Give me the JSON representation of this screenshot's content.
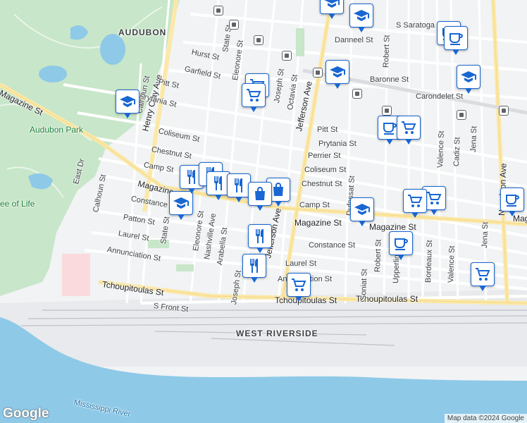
{
  "map": {
    "attribution": "Map data ©2024 Google",
    "logo": "Google",
    "areas": [
      {
        "id": "audubon",
        "text": "AUDUBON"
      },
      {
        "id": "west-riverside",
        "text": "WEST RIVERSIDE"
      }
    ],
    "parks": [
      {
        "id": "audubon-park",
        "text": "Audubon Park"
      },
      {
        "id": "tree-of-life",
        "text": "ee of Life"
      }
    ],
    "water": [
      {
        "id": "mississippi",
        "text": "Mississippi River"
      }
    ],
    "streets": [
      {
        "id": "s1",
        "text": "Henry Clay Ave"
      },
      {
        "id": "s2",
        "text": "Magazine St"
      },
      {
        "id": "s3",
        "text": "Magazine St"
      },
      {
        "id": "s4",
        "text": "Magazine St"
      },
      {
        "id": "s5",
        "text": "Magazine"
      },
      {
        "id": "s6",
        "text": "Tchoupitoulas St"
      },
      {
        "id": "s7",
        "text": "Tchoupitoulas St"
      },
      {
        "id": "s8",
        "text": "Tchoupitoulas St"
      },
      {
        "id": "s9",
        "text": "Jefferson Ave"
      },
      {
        "id": "s10",
        "text": "Jefferson Ave"
      },
      {
        "id": "s11",
        "text": "Prytania St"
      },
      {
        "id": "s12",
        "text": "Prytania St"
      },
      {
        "id": "s13",
        "text": "Coliseum St"
      },
      {
        "id": "s14",
        "text": "Coliseum St"
      },
      {
        "id": "s15",
        "text": "Chestnut St"
      },
      {
        "id": "s16",
        "text": "Chestnut St"
      },
      {
        "id": "s17",
        "text": "Camp St"
      },
      {
        "id": "s18",
        "text": "Camp St"
      },
      {
        "id": "s19",
        "text": "Constance St"
      },
      {
        "id": "s20",
        "text": "Constance St"
      },
      {
        "id": "s21",
        "text": "Patton St"
      },
      {
        "id": "s22",
        "text": "Laurel St"
      },
      {
        "id": "s23",
        "text": "Laurel St"
      },
      {
        "id": "s24",
        "text": "Annunciation St"
      },
      {
        "id": "s25",
        "text": "Annunciation St"
      },
      {
        "id": "s26",
        "text": "S Front St"
      },
      {
        "id": "s27",
        "text": "Pitt St"
      },
      {
        "id": "s28",
        "text": "Pitt St"
      },
      {
        "id": "s29",
        "text": "Garfield St"
      },
      {
        "id": "s30",
        "text": "Hurst St"
      },
      {
        "id": "s31",
        "text": "State St"
      },
      {
        "id": "s32",
        "text": "State St"
      },
      {
        "id": "s33",
        "text": "Eleonore St"
      },
      {
        "id": "s34",
        "text": "Eleonore St"
      },
      {
        "id": "s35",
        "text": "Nashville Ave"
      },
      {
        "id": "s36",
        "text": "Arabella St"
      },
      {
        "id": "s37",
        "text": "Joseph St"
      },
      {
        "id": "s38",
        "text": "Joseph St"
      },
      {
        "id": "s39",
        "text": "Octavia St"
      },
      {
        "id": "s40",
        "text": "Danneel St"
      },
      {
        "id": "s41",
        "text": "S Saratoga St"
      },
      {
        "id": "s42",
        "text": "Baronne St"
      },
      {
        "id": "s43",
        "text": "Carondelet St"
      },
      {
        "id": "s44",
        "text": "Dufossat St"
      },
      {
        "id": "s45",
        "text": "Robert St"
      },
      {
        "id": "s46",
        "text": "Robert St"
      },
      {
        "id": "s47",
        "text": "Perrier St"
      },
      {
        "id": "s48",
        "text": "Valence St"
      },
      {
        "id": "s49",
        "text": "Valence St"
      },
      {
        "id": "s50",
        "text": "Cadiz St"
      },
      {
        "id": "s51",
        "text": "Jena St"
      },
      {
        "id": "s52",
        "text": "Jena St"
      },
      {
        "id": "s53",
        "text": "Soniat St"
      },
      {
        "id": "s54",
        "text": "Bordeaux St"
      },
      {
        "id": "s55",
        "text": "Calhoun St"
      },
      {
        "id": "s56",
        "text": "Calhoun St"
      },
      {
        "id": "s57",
        "text": "East Dr"
      },
      {
        "id": "s58",
        "text": "Upperline St"
      },
      {
        "id": "s59",
        "text": "Napoleon Ave"
      },
      {
        "id": "s60",
        "text": "Magazine St"
      }
    ],
    "pins": [
      {
        "id": "p1",
        "type": "school"
      },
      {
        "id": "p2",
        "type": "school"
      },
      {
        "id": "p3",
        "type": "school"
      },
      {
        "id": "p4",
        "type": "school"
      },
      {
        "id": "p5",
        "type": "school"
      },
      {
        "id": "p6",
        "type": "school"
      },
      {
        "id": "p7",
        "type": "cafe"
      },
      {
        "id": "p8",
        "type": "cafe"
      },
      {
        "id": "p9",
        "type": "cafe"
      },
      {
        "id": "p10",
        "type": "cafe"
      },
      {
        "id": "p11",
        "type": "shopping-cart"
      },
      {
        "id": "p12",
        "type": "shopping-cart"
      },
      {
        "id": "p13",
        "type": "shopping-cart"
      },
      {
        "id": "p14",
        "type": "shopping-cart"
      },
      {
        "id": "p15",
        "type": "shopping-cart"
      },
      {
        "id": "p16",
        "type": "shopping-cart"
      },
      {
        "id": "p17",
        "type": "shopping-cart"
      },
      {
        "id": "p18",
        "type": "restaurant"
      },
      {
        "id": "p19",
        "type": "restaurant"
      },
      {
        "id": "p20",
        "type": "restaurant"
      },
      {
        "id": "p21",
        "type": "restaurant"
      },
      {
        "id": "p22",
        "type": "restaurant"
      },
      {
        "id": "p23",
        "type": "restaurant"
      },
      {
        "id": "p24",
        "type": "shopping-bag"
      },
      {
        "id": "p25",
        "type": "shopping-bag"
      },
      {
        "id": "p26",
        "type": "shopping-cart"
      },
      {
        "id": "p27",
        "type": "school"
      }
    ],
    "colors": {
      "land": "#f1f3f4",
      "park": "#c8e6c9",
      "water": "#8ec9e8",
      "street": "#ffffff",
      "major": "#fce8a7",
      "pin_border": "#1967d2"
    }
  }
}
